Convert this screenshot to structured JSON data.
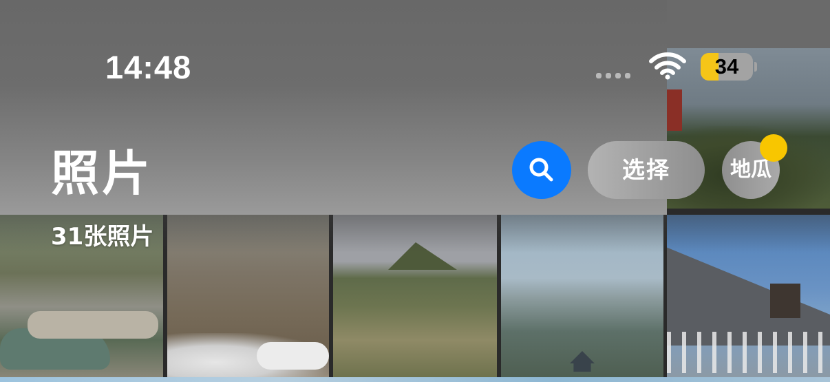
{
  "status_bar": {
    "time": "14:48",
    "battery_percent": "34",
    "battery_level": 0.34,
    "signal_icon": "cellular-signal-dots",
    "wifi_icon": "wifi-icon"
  },
  "header": {
    "title": "照片",
    "subtitle": "31张照片",
    "search_icon": "search-icon",
    "select_label": "选择",
    "avatar_label": "地瓜"
  },
  "colors": {
    "accent": "#0a7aff",
    "battery_fill": "#f5c518",
    "badge": "#f8c600"
  },
  "photos": [
    {
      "name": "photo-mountain-top-right"
    },
    {
      "name": "photo-stream-rocks"
    },
    {
      "name": "photo-snowy-slope"
    },
    {
      "name": "photo-hill-peak"
    },
    {
      "name": "photo-valley-view"
    },
    {
      "name": "photo-great-wall-tower"
    }
  ]
}
